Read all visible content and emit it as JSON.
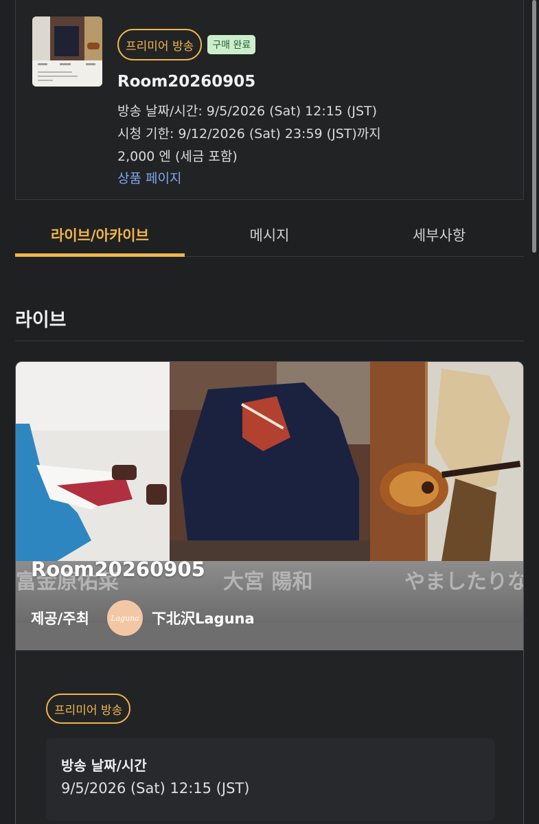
{
  "product": {
    "badge_premiere": "프리미어 방송",
    "badge_purchased": "구매 완료",
    "title": "Room20260905",
    "broadcast_datetime": "방송 날짜/시간: 9/5/2026 (Sat) 12:15 (JST)",
    "watch_deadline": "시청 기한: 9/12/2026 (Sat) 23:59 (JST)까지",
    "price": "2,000 엔 (세금 포함)",
    "product_page_link": "상품 페이지"
  },
  "tabs": [
    {
      "label": "라이브/아카이브",
      "active": true
    },
    {
      "label": "메시지",
      "active": false
    },
    {
      "label": "세부사항",
      "active": false
    }
  ],
  "section": {
    "title": "라이브"
  },
  "live_card": {
    "title": "Room20260905",
    "organizer_label": "제공/주최",
    "organizer_avatar_text": "Laguna",
    "organizer_name": "下北沢Laguna",
    "badge": "프리미어 방송",
    "info_label": "방송 날짜/시간",
    "info_value": "9/5/2026 (Sat) 12:15 (JST)",
    "banner_names": [
      "富金原佑菜",
      "大宮 陽和",
      "やましたりな"
    ]
  },
  "colors": {
    "accent": "#f0b64c",
    "link": "#7fa8ec",
    "purchased_bg": "#cdeecd",
    "background": "#1f2022"
  }
}
